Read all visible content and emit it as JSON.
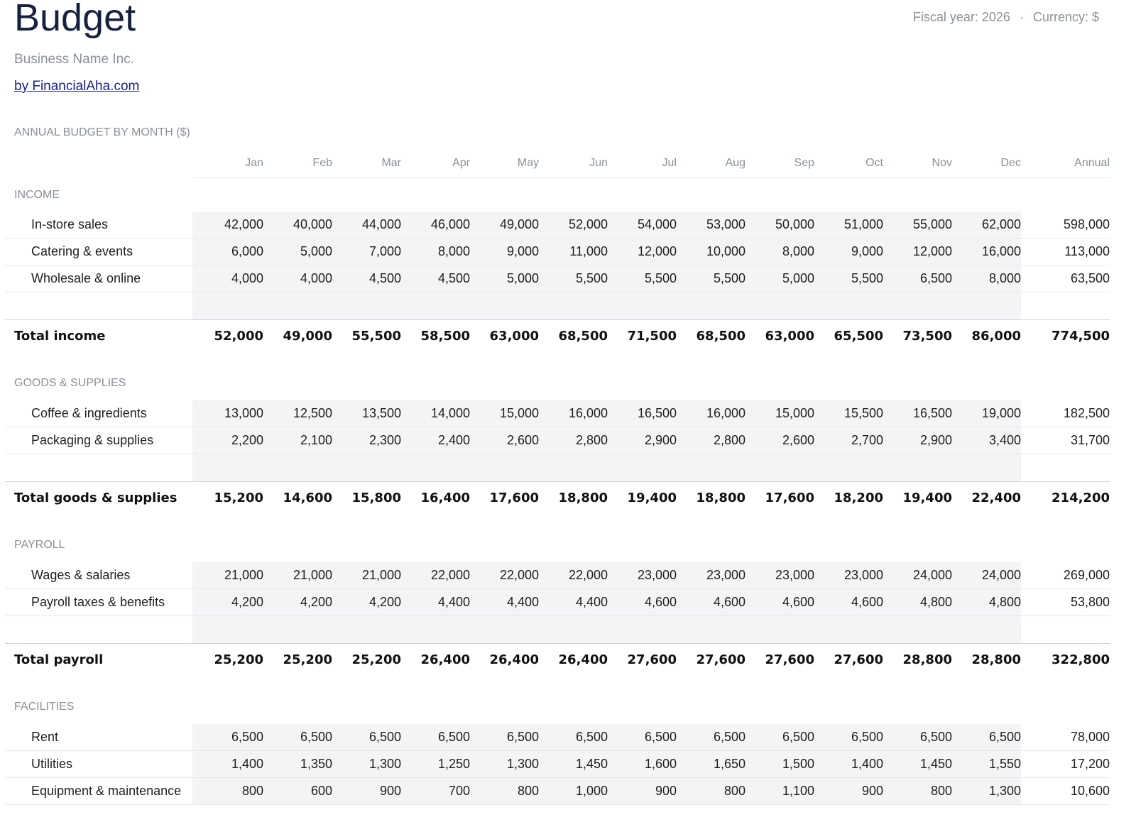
{
  "header": {
    "title": "Budget",
    "business": "Business Name Inc.",
    "link": "by FinancialAha.com",
    "fiscal_year": "Fiscal year: 2026",
    "separator": "·",
    "currency": "Currency: $"
  },
  "caption": "ANNUAL BUDGET BY MONTH ($)",
  "columns": [
    "Jan",
    "Feb",
    "Mar",
    "Apr",
    "May",
    "Jun",
    "Jul",
    "Aug",
    "Sep",
    "Oct",
    "Nov",
    "Dec",
    "Annual"
  ],
  "sections": [
    {
      "name": "INCOME",
      "rows": [
        {
          "label": "In-store sales",
          "values": [
            "42,000",
            "40,000",
            "44,000",
            "46,000",
            "49,000",
            "52,000",
            "54,000",
            "53,000",
            "50,000",
            "51,000",
            "55,000",
            "62,000"
          ],
          "annual": "598,000"
        },
        {
          "label": "Catering & events",
          "values": [
            "6,000",
            "5,000",
            "7,000",
            "8,000",
            "9,000",
            "11,000",
            "12,000",
            "10,000",
            "8,000",
            "9,000",
            "12,000",
            "16,000"
          ],
          "annual": "113,000"
        },
        {
          "label": "Wholesale & online",
          "values": [
            "4,000",
            "4,000",
            "4,500",
            "4,500",
            "5,000",
            "5,500",
            "5,500",
            "5,500",
            "5,000",
            "5,500",
            "6,500",
            "8,000"
          ],
          "annual": "63,500"
        }
      ],
      "total": {
        "label": "Total income",
        "values": [
          "52,000",
          "49,000",
          "55,500",
          "58,500",
          "63,000",
          "68,500",
          "71,500",
          "68,500",
          "63,000",
          "65,500",
          "73,500",
          "86,000"
        ],
        "annual": "774,500"
      }
    },
    {
      "name": "GOODS & SUPPLIES",
      "rows": [
        {
          "label": "Coffee & ingredients",
          "values": [
            "13,000",
            "12,500",
            "13,500",
            "14,000",
            "15,000",
            "16,000",
            "16,500",
            "16,000",
            "15,000",
            "15,500",
            "16,500",
            "19,000"
          ],
          "annual": "182,500"
        },
        {
          "label": "Packaging & supplies",
          "values": [
            "2,200",
            "2,100",
            "2,300",
            "2,400",
            "2,600",
            "2,800",
            "2,900",
            "2,800",
            "2,600",
            "2,700",
            "2,900",
            "3,400"
          ],
          "annual": "31,700"
        }
      ],
      "total": {
        "label": "Total goods & supplies",
        "values": [
          "15,200",
          "14,600",
          "15,800",
          "16,400",
          "17,600",
          "18,800",
          "19,400",
          "18,800",
          "17,600",
          "18,200",
          "19,400",
          "22,400"
        ],
        "annual": "214,200"
      }
    },
    {
      "name": "PAYROLL",
      "rows": [
        {
          "label": "Wages & salaries",
          "values": [
            "21,000",
            "21,000",
            "21,000",
            "22,000",
            "22,000",
            "22,000",
            "23,000",
            "23,000",
            "23,000",
            "23,000",
            "24,000",
            "24,000"
          ],
          "annual": "269,000"
        },
        {
          "label": "Payroll taxes & benefits",
          "values": [
            "4,200",
            "4,200",
            "4,200",
            "4,400",
            "4,400",
            "4,400",
            "4,600",
            "4,600",
            "4,600",
            "4,600",
            "4,800",
            "4,800"
          ],
          "annual": "53,800"
        }
      ],
      "total": {
        "label": "Total payroll",
        "values": [
          "25,200",
          "25,200",
          "25,200",
          "26,400",
          "26,400",
          "26,400",
          "27,600",
          "27,600",
          "27,600",
          "27,600",
          "28,800",
          "28,800"
        ],
        "annual": "322,800"
      }
    },
    {
      "name": "FACILITIES",
      "rows": [
        {
          "label": "Rent",
          "values": [
            "6,500",
            "6,500",
            "6,500",
            "6,500",
            "6,500",
            "6,500",
            "6,500",
            "6,500",
            "6,500",
            "6,500",
            "6,500",
            "6,500"
          ],
          "annual": "78,000"
        },
        {
          "label": "Utilities",
          "values": [
            "1,400",
            "1,350",
            "1,300",
            "1,250",
            "1,300",
            "1,450",
            "1,600",
            "1,650",
            "1,500",
            "1,400",
            "1,450",
            "1,550"
          ],
          "annual": "17,200"
        },
        {
          "label": "Equipment & maintenance",
          "values": [
            "800",
            "600",
            "900",
            "700",
            "800",
            "1,000",
            "900",
            "800",
            "1,100",
            "900",
            "800",
            "1,300"
          ],
          "annual": "10,600"
        }
      ]
    }
  ]
}
